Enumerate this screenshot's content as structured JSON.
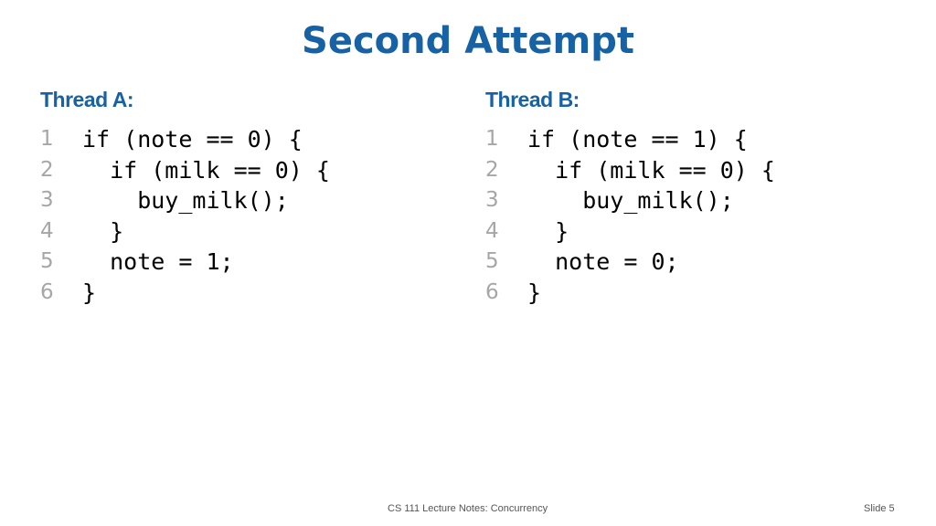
{
  "slide": {
    "title": "Second Attempt",
    "colors": {
      "accent": "#1762a4",
      "line_number": "#a6a6a6",
      "footer": "#555555"
    },
    "threads": [
      {
        "heading": "Thread A:",
        "lines": [
          {
            "num": "1",
            "code": "if (note == 0) {"
          },
          {
            "num": "2",
            "code": "  if (milk == 0) {"
          },
          {
            "num": "3",
            "code": "    buy_milk();"
          },
          {
            "num": "4",
            "code": "  }"
          },
          {
            "num": "5",
            "code": "  note = 1;"
          },
          {
            "num": "6",
            "code": "}"
          }
        ]
      },
      {
        "heading": "Thread B:",
        "lines": [
          {
            "num": "1",
            "code": "if (note == 1) {"
          },
          {
            "num": "2",
            "code": "  if (milk == 0) {"
          },
          {
            "num": "3",
            "code": "    buy_milk();"
          },
          {
            "num": "4",
            "code": "  }"
          },
          {
            "num": "5",
            "code": "  note = 0;"
          },
          {
            "num": "6",
            "code": "}"
          }
        ]
      }
    ],
    "footer": {
      "course": "CS 111 Lecture Notes: Concurrency",
      "slide_number": "Slide 5"
    }
  }
}
